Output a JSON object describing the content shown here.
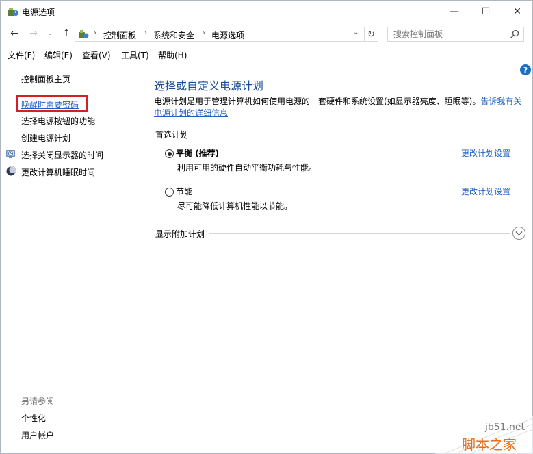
{
  "window": {
    "title": "电源选项",
    "controls": {
      "minimize": "—",
      "maximize": "☐",
      "close": "✕"
    }
  },
  "nav": {
    "back": "←",
    "forward": "→",
    "recent": "⌄",
    "up": "↑",
    "breadcrumbs": [
      "控制面板",
      "系统和安全",
      "电源选项"
    ],
    "separator": "›",
    "dropdown": "⌄",
    "refresh": "↻",
    "search_placeholder": "搜索控制面板"
  },
  "menu": [
    "文件(F)",
    "编辑(E)",
    "查看(V)",
    "工具(T)",
    "帮助(H)"
  ],
  "help": "?",
  "sidebar": {
    "home": "控制面板主页",
    "links": [
      {
        "label": "唤醒时需要密码",
        "highlighted": true
      },
      {
        "label": "选择电源按钮的功能"
      },
      {
        "label": "创建电源计划"
      },
      {
        "label": "选择关闭显示器的时间",
        "icon": "monitor-clock-icon"
      },
      {
        "label": "更改计算机睡眠时间",
        "icon": "moon-icon"
      }
    ],
    "see_also": {
      "title": "另请参阅",
      "items": [
        "个性化",
        "用户帐户"
      ]
    }
  },
  "main": {
    "title": "选择或自定义电源计划",
    "description": "电源计划是用于管理计算机如何使用电源的一套硬件和系统设置(如显示器亮度、睡眠等)。",
    "description_link": "告诉我有关电源计划的详细信息",
    "preferred_label": "首选计划",
    "plans": [
      {
        "name": "平衡 (推荐)",
        "desc": "利用可用的硬件自动平衡功耗与性能。",
        "link": "更改计划设置",
        "selected": true
      },
      {
        "name": "节能",
        "desc": "尽可能降低计算机性能以节能。",
        "link": "更改计划设置",
        "selected": false
      }
    ],
    "extra_label": "显示附加计划"
  },
  "watermark": {
    "site": "jb51.net",
    "text": "脚本之家"
  },
  "colors": {
    "link": "#1f5fc3",
    "title": "#1e4c9b",
    "highlight": "#d42025",
    "help": "#1a6fc7",
    "watermark": "#e2701e"
  }
}
